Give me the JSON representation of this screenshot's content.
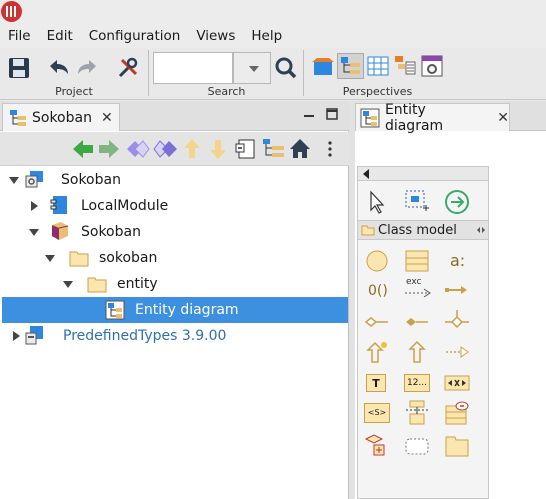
{
  "menu": [
    "File",
    "Edit",
    "Configuration",
    "Views",
    "Help"
  ],
  "toolbar": {
    "groups": {
      "project": "Project",
      "search": "Search",
      "perspectives": "Perspectives"
    },
    "search_value": ""
  },
  "left_panel": {
    "tab_title": "Sokoban",
    "tree": [
      {
        "label": "Sokoban",
        "expanded": true,
        "selected": false
      },
      {
        "label": "LocalModule",
        "expanded": false,
        "selected": false
      },
      {
        "label": "Sokoban",
        "expanded": true,
        "selected": false
      },
      {
        "label": "sokoban",
        "expanded": true,
        "selected": false
      },
      {
        "label": "entity",
        "expanded": true,
        "selected": false
      },
      {
        "label": "Entity diagram",
        "expanded": false,
        "selected": true
      },
      {
        "label": "PredefinedTypes 3.9.00",
        "expanded": false,
        "selected": false
      }
    ]
  },
  "right_panel": {
    "tab_title": "Entity diagram",
    "palette_section": "Class model",
    "palette_tools": [
      "a:",
      "0()",
      "exc",
      "T",
      "12...",
      "<S>"
    ]
  },
  "colors": {
    "selection": "#3d8fe0",
    "predefined_text": "#2f6fb5",
    "folder": "#f5d78c",
    "accent_red": "#cc3333",
    "arrow_green": "#3aa843"
  }
}
